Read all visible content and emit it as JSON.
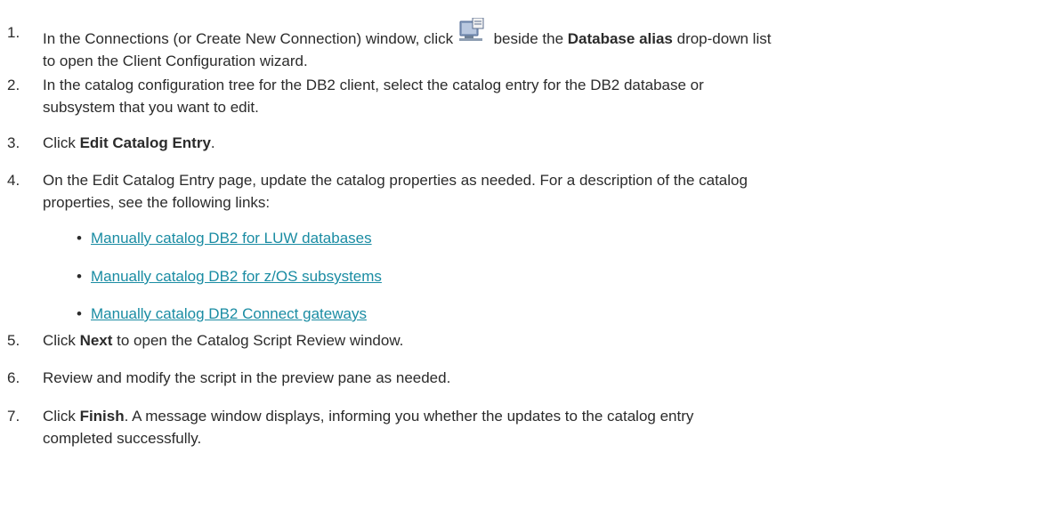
{
  "steps": [
    {
      "num": "1.",
      "pre": "In the Connections (or Create New Connection) window, click ",
      "icon": "client-configuration-icon",
      "mid": " beside the ",
      "bold": "Database alias",
      "post": " drop-down list",
      "line2": "to open the Client Configuration wizard."
    },
    {
      "num": "2.",
      "line1": "In the catalog configuration tree for the DB2 client, select the catalog entry for the DB2 database or",
      "line2": "subsystem that you want to edit."
    },
    {
      "num": "3.",
      "pre": "Click ",
      "bold": "Edit Catalog Entry",
      "post": "."
    },
    {
      "num": "4.",
      "line1": "On the Edit Catalog Entry page, update the catalog properties as needed. For a description of the catalog",
      "line2": "properties, see the following links:"
    },
    {
      "num": "5.",
      "pre": "Click ",
      "bold": "Next",
      "post": " to open the Catalog Script Review window."
    },
    {
      "num": "6.",
      "line1": "Review and modify the script in the preview pane as needed."
    },
    {
      "num": "7.",
      "pre": "Click ",
      "bold": "Finish",
      "post": ". A message window displays, informing you whether the updates to the catalog entry",
      "line2": "completed successfully."
    }
  ],
  "links": [
    "Manually catalog DB2 for LUW databases",
    "Manually catalog DB2 for z/OS subsystems",
    "Manually catalog DB2 Connect gateways"
  ],
  "colors": {
    "text": "#2b2b2b",
    "link": "#1a8ca3"
  }
}
